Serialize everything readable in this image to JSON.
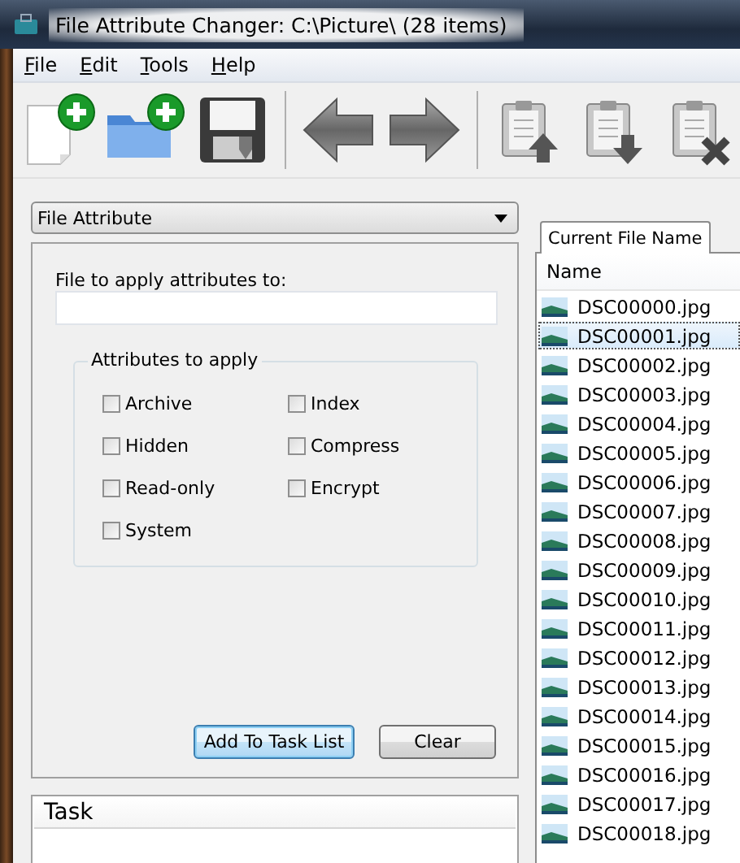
{
  "window": {
    "title": "File Attribute Changer: C:\\Picture\\ (28 items)"
  },
  "menu": [
    {
      "label": "File"
    },
    {
      "label": "Edit"
    },
    {
      "label": "Tools"
    },
    {
      "label": "Help"
    }
  ],
  "toolbar": [
    {
      "kind": "new-file"
    },
    {
      "kind": "add-folder"
    },
    {
      "kind": "save"
    },
    {
      "kind": "separator"
    },
    {
      "kind": "back"
    },
    {
      "kind": "forward"
    },
    {
      "kind": "separator"
    },
    {
      "kind": "move-up"
    },
    {
      "kind": "move-down"
    },
    {
      "kind": "delete"
    }
  ],
  "mode_dropdown": {
    "value": "File Attribute"
  },
  "file_field": {
    "label": "File to apply attributes to:"
  },
  "attributes": {
    "title": "Attributes to apply",
    "options": [
      {
        "label": "Archive",
        "checked": false
      },
      {
        "label": "Hidden",
        "checked": false
      },
      {
        "label": "Read-only",
        "checked": false
      },
      {
        "label": "System",
        "checked": false
      },
      {
        "label": "Index",
        "checked": false
      },
      {
        "label": "Compress",
        "checked": false
      },
      {
        "label": "Encrypt",
        "checked": false
      }
    ]
  },
  "buttons": [
    {
      "label": "Add To Task List",
      "default": true
    },
    {
      "label": "Clear",
      "default": false
    }
  ],
  "task_panel": {
    "header": "Task"
  },
  "file_list": {
    "tab": "Current File Name",
    "column": "Name",
    "rows": [
      {
        "name": "DSC00000.jpg",
        "selected": false
      },
      {
        "name": "DSC00001.jpg",
        "selected": true
      },
      {
        "name": "DSC00002.jpg",
        "selected": false
      },
      {
        "name": "DSC00003.jpg",
        "selected": false
      },
      {
        "name": "DSC00004.jpg",
        "selected": false
      },
      {
        "name": "DSC00005.jpg",
        "selected": false
      },
      {
        "name": "DSC00006.jpg",
        "selected": false
      },
      {
        "name": "DSC00007.jpg",
        "selected": false
      },
      {
        "name": "DSC00008.jpg",
        "selected": false
      },
      {
        "name": "DSC00009.jpg",
        "selected": false
      },
      {
        "name": "DSC00010.jpg",
        "selected": false
      },
      {
        "name": "DSC00011.jpg",
        "selected": false
      },
      {
        "name": "DSC00012.jpg",
        "selected": false
      },
      {
        "name": "DSC00013.jpg",
        "selected": false
      },
      {
        "name": "DSC00014.jpg",
        "selected": false
      },
      {
        "name": "DSC00015.jpg",
        "selected": false
      },
      {
        "name": "DSC00016.jpg",
        "selected": false
      },
      {
        "name": "DSC00017.jpg",
        "selected": false
      },
      {
        "name": "DSC00018.jpg",
        "selected": false
      }
    ]
  }
}
